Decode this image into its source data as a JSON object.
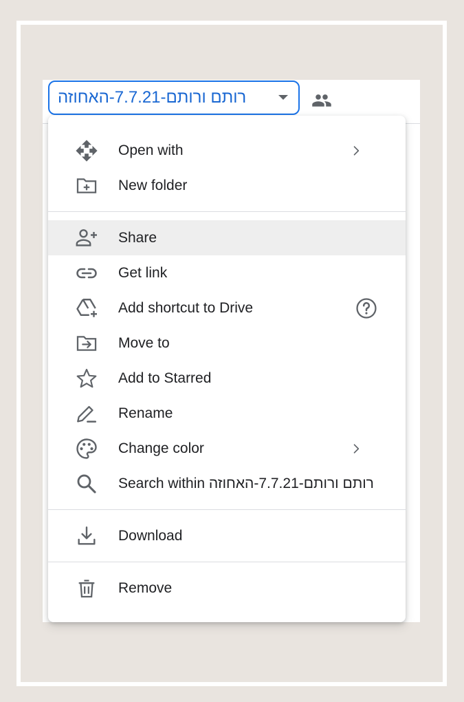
{
  "header": {
    "folder_name": "רותם ורותם-7.7.21-האחוזה"
  },
  "menu": {
    "groups": [
      [
        {
          "label": "Open with",
          "icon": "open-with-icon",
          "trailing": "chevron-right-icon"
        },
        {
          "label": "New folder",
          "icon": "new-folder-icon"
        }
      ],
      [
        {
          "label": "Share",
          "icon": "person-add-icon",
          "highlighted": true
        },
        {
          "label": "Get link",
          "icon": "link-icon"
        },
        {
          "label": "Add shortcut to Drive",
          "icon": "add-shortcut-icon",
          "trailing": "help-icon"
        },
        {
          "label": "Move to",
          "icon": "move-to-folder-icon"
        },
        {
          "label": "Add to Starred",
          "icon": "star-outline-icon"
        },
        {
          "label": "Rename",
          "icon": "rename-pen-icon"
        },
        {
          "label": "Change color",
          "icon": "palette-icon",
          "trailing": "chevron-right-icon"
        },
        {
          "label": "Search within רותם ורותם-7.7.21-האחוזה",
          "icon": "search-icon"
        }
      ],
      [
        {
          "label": "Download",
          "icon": "download-icon"
        }
      ],
      [
        {
          "label": "Remove",
          "icon": "trash-icon"
        }
      ]
    ]
  },
  "colors": {
    "accent": "#1a73e8",
    "text": "#202124",
    "icon": "#5f6368",
    "highlight": "#eeeeee",
    "background": "#e9e4df"
  }
}
